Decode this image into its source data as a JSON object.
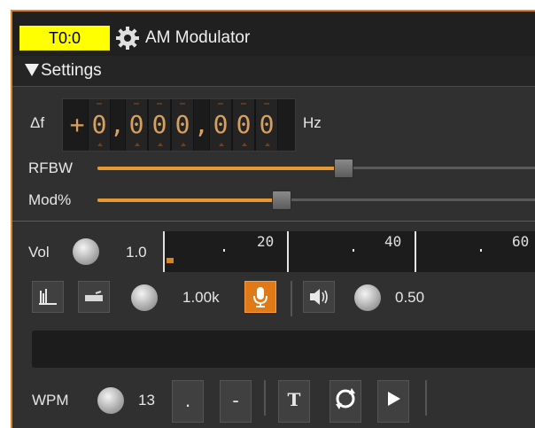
{
  "header": {
    "channel_id": "T0:0",
    "title": "AM Modulator"
  },
  "settings": {
    "label": "Settings",
    "expanded": true
  },
  "frequency": {
    "label": "Δf",
    "digits": [
      "+",
      "0",
      ",",
      "0",
      "0",
      "0",
      ",",
      "0",
      "0",
      "0"
    ],
    "unit": "Hz"
  },
  "rfbw": {
    "label": "RFBW",
    "level": 0.55
  },
  "mod": {
    "label": "Mod%",
    "level": 0.41
  },
  "volume": {
    "label": "Vol",
    "value": "1.0"
  },
  "meter": {
    "labels": [
      "20",
      "40",
      "60"
    ]
  },
  "audio": {
    "freq_value": "1.00k",
    "gain_value": "0.50"
  },
  "morse": {
    "wpm_label": "WPM",
    "wpm_value": "13",
    "dot_label": ".",
    "dash_label": "-",
    "text_label": "T"
  },
  "colors": {
    "accent": "#e89830",
    "active_button": "#e07a18",
    "id_badge": "#ffff00"
  },
  "icons": [
    "gear-icon",
    "spectrum-icon",
    "tone-icon",
    "microphone-icon",
    "speaker-icon",
    "repeat-icon",
    "play-icon"
  ]
}
